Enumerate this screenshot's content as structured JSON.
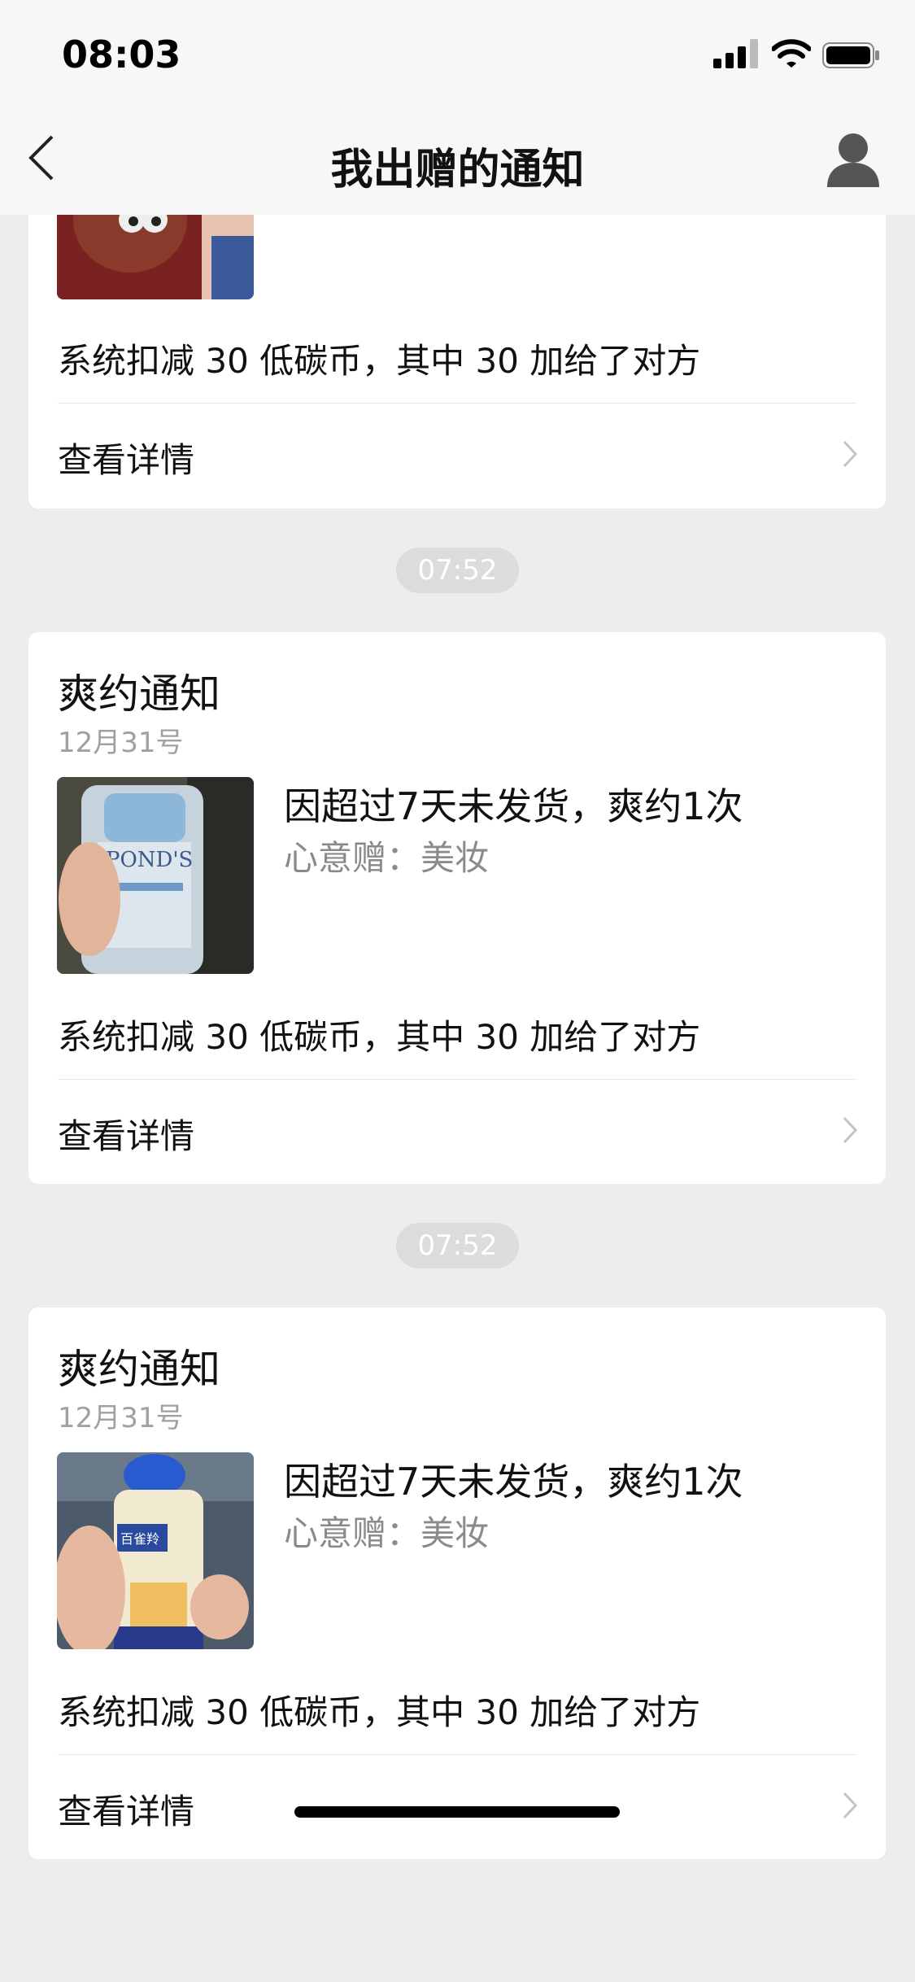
{
  "status_bar": {
    "time": "08:03"
  },
  "nav": {
    "title": "我出赠的通知"
  },
  "cards": [
    {
      "system_text": "系统扣减 30 低碳币，其中 30 加给了对方",
      "detail_label": "查看详情"
    },
    {
      "title": "爽约通知",
      "date": "12月31号",
      "item_title": "因超过7天未发货，爽约1次",
      "item_sub": "心意赠：美妆",
      "system_text": "系统扣减 30 低碳币，其中 30 加给了对方",
      "detail_label": "查看详情"
    },
    {
      "title": "爽约通知",
      "date": "12月31号",
      "item_title": "因超过7天未发货，爽约1次",
      "item_sub": "心意赠：美妆",
      "system_text": "系统扣减 30 低碳币，其中 30 加给了对方",
      "detail_label": "查看详情"
    }
  ],
  "timestamps": [
    "07:52",
    "07:52"
  ]
}
